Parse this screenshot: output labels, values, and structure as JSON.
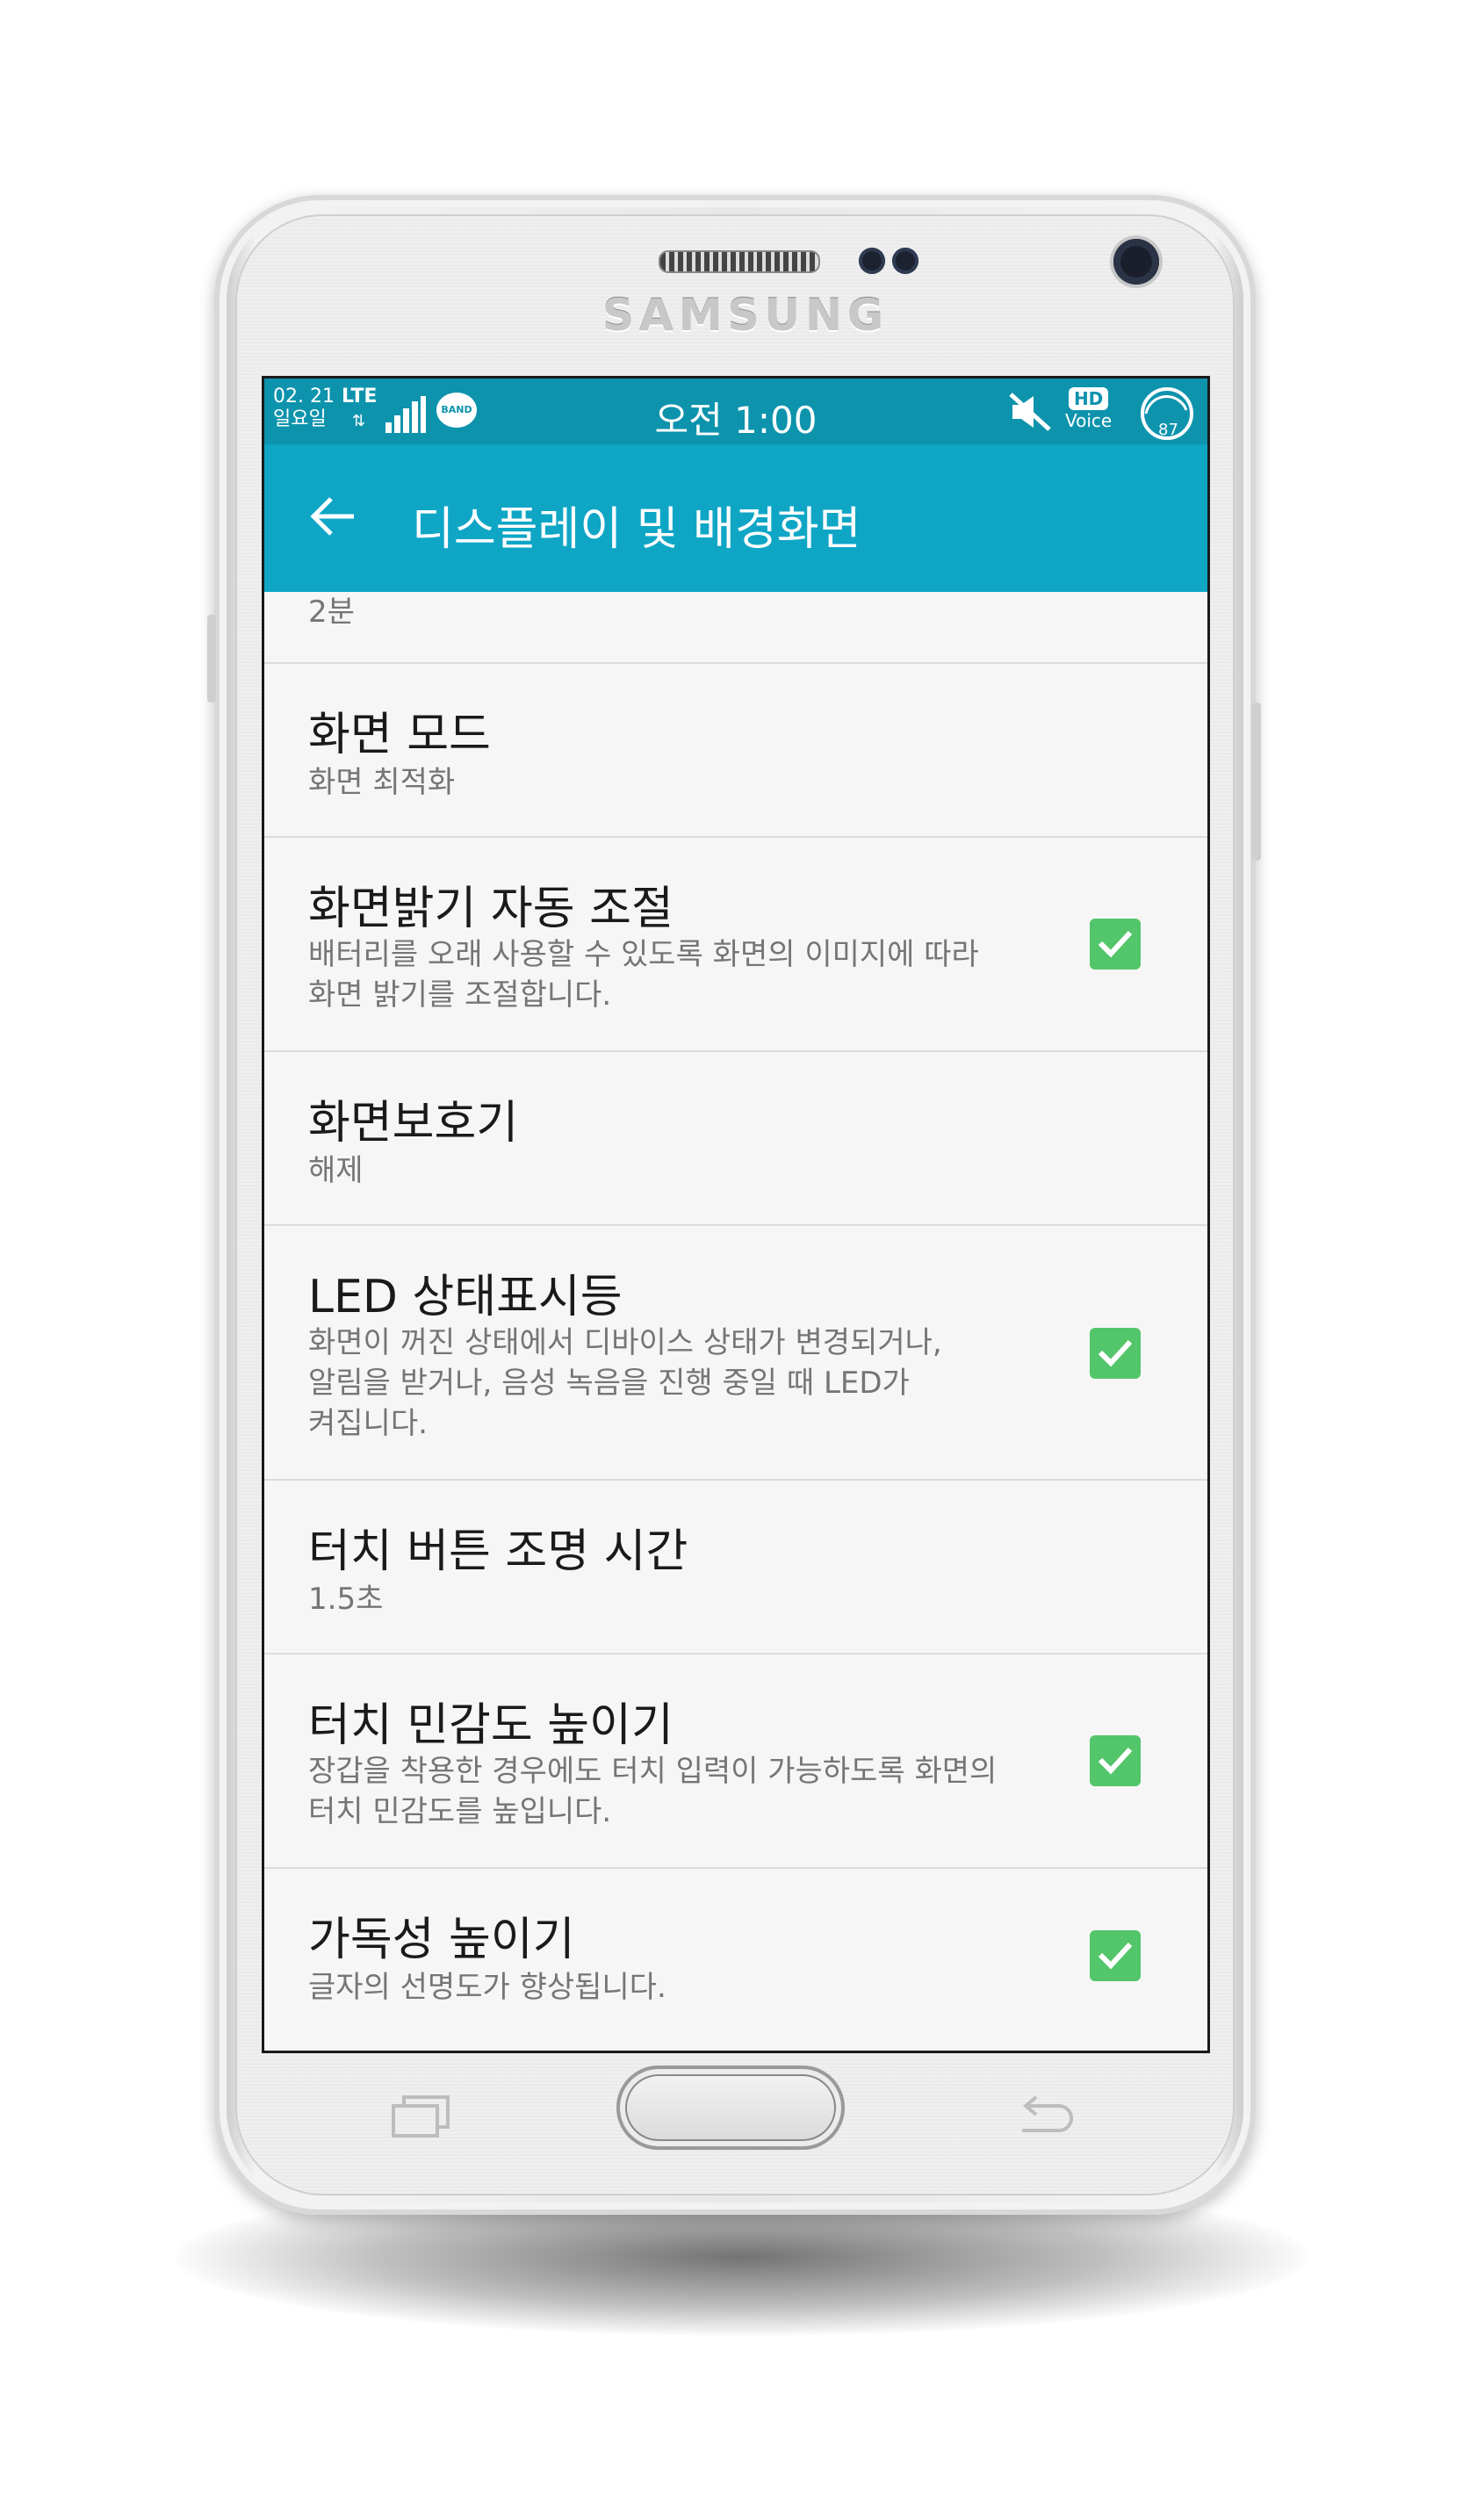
{
  "device": {
    "brand": "SAMSUNG"
  },
  "statusbar": {
    "date": "02. 21",
    "weekday": "일요일",
    "network": "LTE",
    "band_label": "BAND",
    "time": "오전 1:00",
    "hd": "HD",
    "voice": "Voice",
    "battery": "87"
  },
  "appbar": {
    "title": "디스플레이 및 배경화면"
  },
  "colors": {
    "statusbar": "#0e93ad",
    "appbar": "#0fa6c6",
    "checkbox": "#53c56a"
  },
  "settings": [
    {
      "summary": "2분"
    },
    {
      "title": "화면 모드",
      "summary": "화면 최적화"
    },
    {
      "title": "화면밝기 자동 조절",
      "summary_lines": [
        "배터리를 오래 사용할 수 있도록 화면의 이미지에 따라",
        "화면 밝기를 조절합니다."
      ],
      "checked": true
    },
    {
      "title": "화면보호기",
      "summary": "해제"
    },
    {
      "title": "LED 상태표시등",
      "summary_lines": [
        "화면이 꺼진 상태에서 디바이스 상태가 변경되거나,",
        "알림을 받거나, 음성 녹음을 진행 중일 때 LED가",
        "켜집니다."
      ],
      "checked": true
    },
    {
      "title": "터치 버튼 조명 시간",
      "summary": "1.5초"
    },
    {
      "title": "터치 민감도 높이기",
      "summary_lines": [
        "장갑을 착용한 경우에도 터치 입력이 가능하도록 화면의",
        "터치 민감도를 높입니다."
      ],
      "checked": true
    },
    {
      "title": "가독성 높이기",
      "summary": "글자의 선명도가 향상됩니다.",
      "checked": true
    }
  ],
  "icons": [
    "back-arrow-icon",
    "signal-icon",
    "band-icon",
    "mute-icon",
    "battery-icon",
    "check-icon",
    "recent-apps-icon",
    "back-icon"
  ]
}
